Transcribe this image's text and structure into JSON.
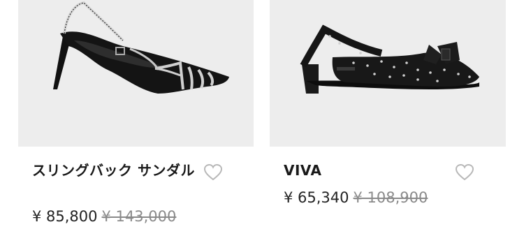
{
  "products": [
    {
      "name": "スリングバック サンダル",
      "sale_price": "¥ 85,800",
      "original_price": "¥ 143,000"
    },
    {
      "name": "VIVA",
      "sale_price": "¥ 65,340",
      "original_price": "¥ 108,900"
    }
  ],
  "icons": {
    "favorite": "heart-outline-icon"
  },
  "colors": {
    "image_background": "#ededed",
    "original_price": "#8a8a8a",
    "heart_outline": "#b8b8b8"
  }
}
